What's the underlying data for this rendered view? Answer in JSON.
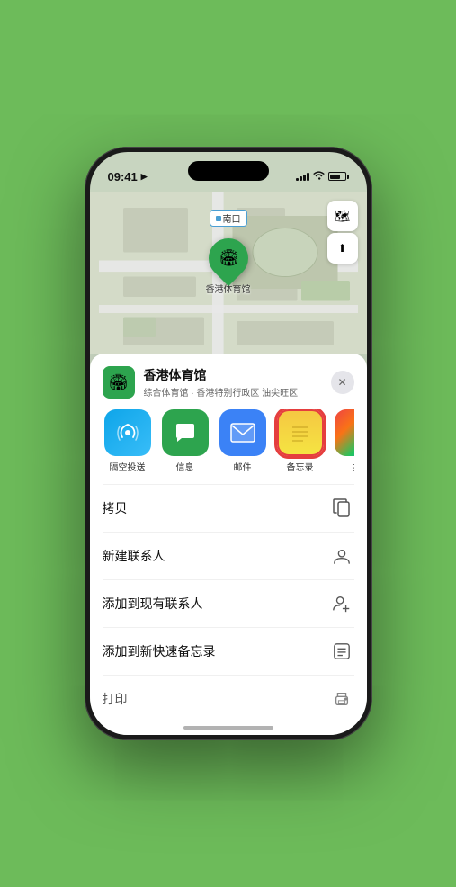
{
  "status_bar": {
    "time": "09:41",
    "location_arrow": "▶"
  },
  "map": {
    "label": "南口",
    "controls": {
      "map_icon": "🗺",
      "location_icon": "↑"
    }
  },
  "pin": {
    "label": "香港体育馆"
  },
  "sheet": {
    "venue_name": "香港体育馆",
    "venue_sub": "综合体育馆 · 香港特别行政区 油尖旺区",
    "close_label": "✕"
  },
  "app_icons": [
    {
      "id": "airdrop",
      "label": "隔空投送"
    },
    {
      "id": "messages",
      "label": "信息"
    },
    {
      "id": "mail",
      "label": "邮件"
    },
    {
      "id": "notes",
      "label": "备忘录"
    },
    {
      "id": "more",
      "label": "推"
    }
  ],
  "actions": [
    {
      "label": "拷贝",
      "icon": "copy"
    },
    {
      "label": "新建联系人",
      "icon": "person"
    },
    {
      "label": "添加到现有联系人",
      "icon": "person-add"
    },
    {
      "label": "添加到新快速备忘录",
      "icon": "note"
    },
    {
      "label": "打印",
      "icon": "print"
    }
  ]
}
